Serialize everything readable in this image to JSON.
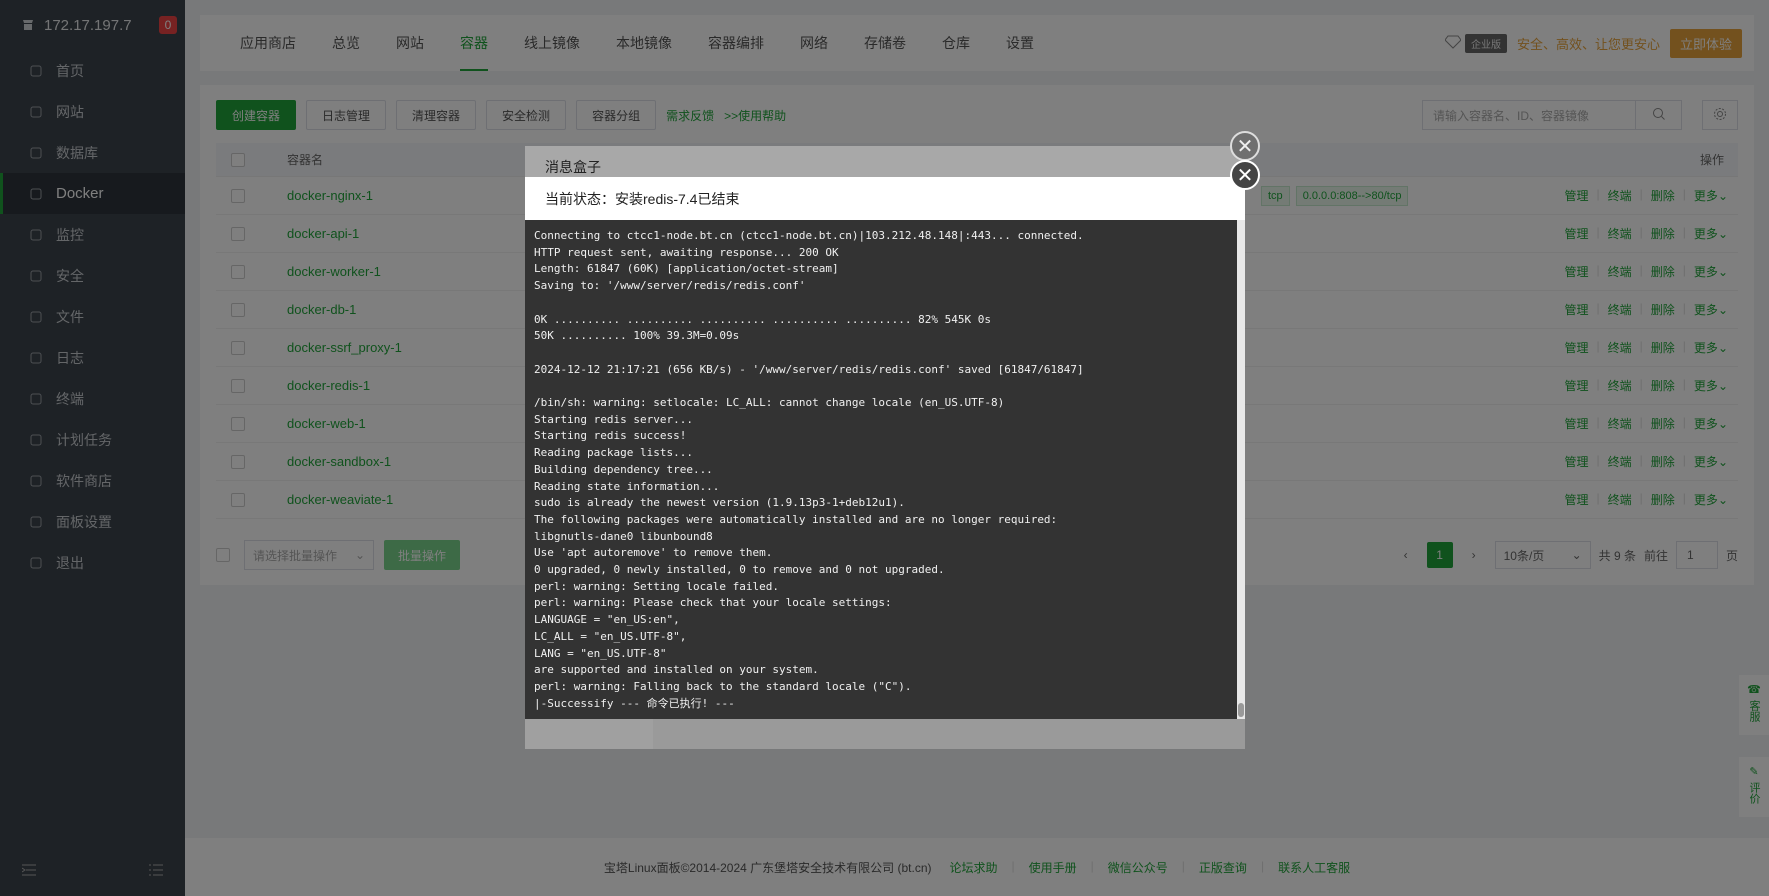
{
  "sidebar": {
    "ip": "172.17.197.7",
    "badge": "0",
    "items": [
      {
        "label": "首页",
        "icon": "home-icon",
        "active": false
      },
      {
        "label": "网站",
        "icon": "globe-icon",
        "active": false
      },
      {
        "label": "数据库",
        "icon": "database-icon",
        "active": false
      },
      {
        "label": "Docker",
        "icon": "docker-icon",
        "active": true
      },
      {
        "label": "监控",
        "icon": "monitor-icon",
        "active": false
      },
      {
        "label": "安全",
        "icon": "shield-icon",
        "active": false
      },
      {
        "label": "文件",
        "icon": "folder-icon",
        "active": false
      },
      {
        "label": "日志",
        "icon": "log-icon",
        "active": false
      },
      {
        "label": "终端",
        "icon": "terminal-icon",
        "active": false
      },
      {
        "label": "计划任务",
        "icon": "clock-icon",
        "active": false
      },
      {
        "label": "软件商店",
        "icon": "store-icon",
        "active": false
      },
      {
        "label": "面板设置",
        "icon": "settings-icon",
        "active": false
      },
      {
        "label": "退出",
        "icon": "logout-icon",
        "active": false
      }
    ]
  },
  "topnav": {
    "tabs": [
      "应用商店",
      "总览",
      "网站",
      "容器",
      "线上镜像",
      "本地镜像",
      "容器编排",
      "网络",
      "存储卷",
      "仓库",
      "设置"
    ],
    "active_tab": 3,
    "enterprise_tag": "企业版",
    "promo_text": "安全、高效、让您更安心",
    "promo_button": "立即体验"
  },
  "toolbar": {
    "create": "创建容器",
    "logs": "日志管理",
    "clean": "清理容器",
    "security": "安全检测",
    "groups": "容器分组",
    "feedback": "需求反馈",
    "help": ">>使用帮助",
    "search_placeholder": "请输入容器名、ID、容器镜像"
  },
  "table": {
    "col_name": "容器名",
    "col_ops": "操作",
    "rows": [
      "docker-nginx-1",
      "docker-api-1",
      "docker-worker-1",
      "docker-db-1",
      "docker-ssrf_proxy-1",
      "docker-redis-1",
      "docker-web-1",
      "docker-sandbox-1",
      "docker-weaviate-1"
    ],
    "port_tag_1": "tcp",
    "port_tag_2": "0.0.0.0:808-->80/tcp",
    "op_manage": "管理",
    "op_terminal": "终端",
    "op_delete": "删除",
    "op_more": "更多"
  },
  "pager": {
    "batch_placeholder": "请选择批量操作",
    "batch_button": "批量操作",
    "current_page": "1",
    "page_size": "10条/页",
    "total": "共 9 条",
    "goto": "前往",
    "goto_value": "1",
    "page_unit": "页"
  },
  "footer": {
    "copyright": "宝塔Linux面板©2014-2024 广东堡塔安全技术有限公司 (bt.cn)",
    "links": [
      "论坛求助",
      "使用手册",
      "微信公众号",
      "正版查询",
      "联系人工客服"
    ]
  },
  "side_float": {
    "service": "客服",
    "review": "评价"
  },
  "dialog_back": {
    "title": "消息盒子"
  },
  "dialog_front": {
    "status": "当前状态：安装redis-7.4已结束",
    "log": "Connecting to ctcc1-node.bt.cn (ctcc1-node.bt.cn)|103.212.48.148|:443... connected.\nHTTP request sent, awaiting response... 200 OK\nLength: 61847 (60K) [application/octet-stream]\nSaving to: '/www/server/redis/redis.conf'\n\n0K .......... .......... .......... .......... .......... 82% 545K 0s\n50K .......... 100% 39.3M=0.09s\n\n2024-12-12 21:17:21 (656 KB/s) - '/www/server/redis/redis.conf' saved [61847/61847]\n\n/bin/sh: warning: setlocale: LC_ALL: cannot change locale (en_US.UTF-8)\nStarting redis server...\nStarting redis success!\nReading package lists...\nBuilding dependency tree...\nReading state information...\nsudo is already the newest version (1.9.13p3-1+deb12u1).\nThe following packages were automatically installed and are no longer required:\nlibgnutls-dane0 libunbound8\nUse 'apt autoremove' to remove them.\n0 upgraded, 0 newly installed, 0 to remove and 0 not upgraded.\nperl: warning: Setting locale failed.\nperl: warning: Please check that your locale settings:\nLANGUAGE = \"en_US:en\",\nLC_ALL = \"en_US.UTF-8\",\nLANG = \"en_US.UTF-8\"\nare supported and installed on your system.\nperl: warning: Falling back to the standard locale (\"C\").\n|-Successify --- 命令已执行! ---"
  },
  "colors": {
    "accent": "#20a53a",
    "sidebar_bg": "#3c444d",
    "terminal_bg": "#333333"
  }
}
